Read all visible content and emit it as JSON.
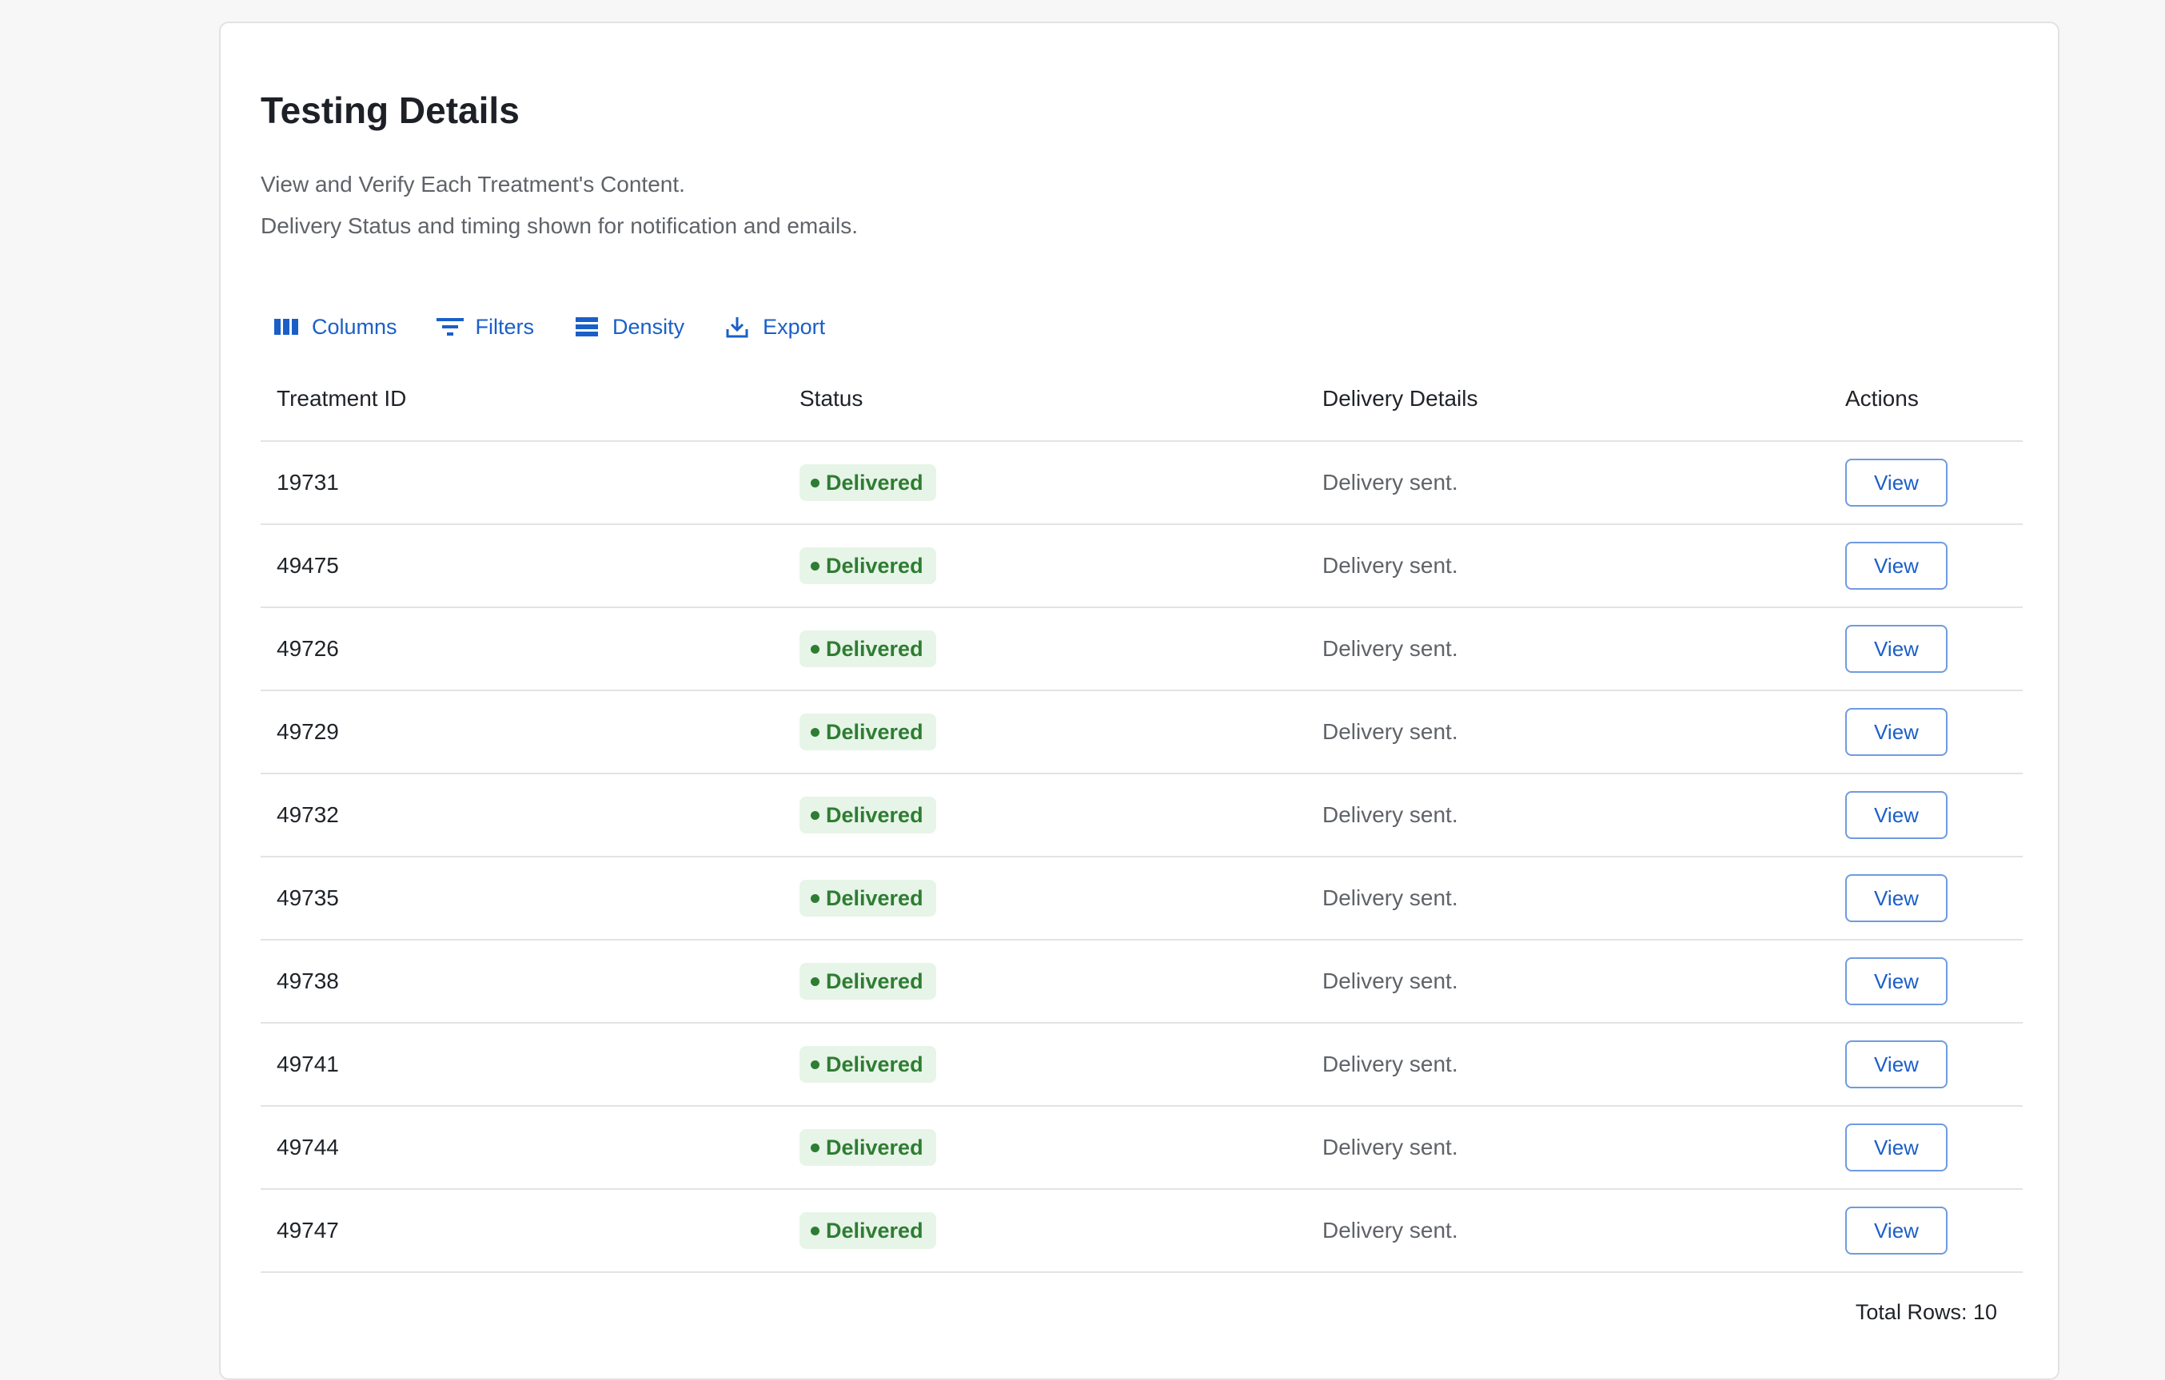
{
  "page": {
    "title": "Testing Details",
    "subtitle_line1": "View and Verify Each Treatment's Content.",
    "subtitle_line2": "Delivery Status and timing shown for notification and emails."
  },
  "toolbar": {
    "columns_label": "Columns",
    "filters_label": "Filters",
    "density_label": "Density",
    "export_label": "Export",
    "accent_color": "#1a5fc8"
  },
  "table": {
    "headers": [
      "Treatment ID",
      "Status",
      "Delivery Details",
      "Actions"
    ],
    "rows": [
      {
        "id": "19731",
        "status": "Delivered",
        "details": "Delivery sent.",
        "action": "View"
      },
      {
        "id": "49475",
        "status": "Delivered",
        "details": "Delivery sent.",
        "action": "View"
      },
      {
        "id": "49726",
        "status": "Delivered",
        "details": "Delivery sent.",
        "action": "View"
      },
      {
        "id": "49729",
        "status": "Delivered",
        "details": "Delivery sent.",
        "action": "View"
      },
      {
        "id": "49732",
        "status": "Delivered",
        "details": "Delivery sent.",
        "action": "View"
      },
      {
        "id": "49735",
        "status": "Delivered",
        "details": "Delivery sent.",
        "action": "View"
      },
      {
        "id": "49738",
        "status": "Delivered",
        "details": "Delivery sent.",
        "action": "View"
      },
      {
        "id": "49741",
        "status": "Delivered",
        "details": "Delivery sent.",
        "action": "View"
      },
      {
        "id": "49744",
        "status": "Delivered",
        "details": "Delivery sent.",
        "action": "View"
      },
      {
        "id": "49747",
        "status": "Delivered",
        "details": "Delivery sent.",
        "action": "View"
      }
    ],
    "status_color": "#2e7d32",
    "status_bg": "#e7f4e8"
  },
  "footer": {
    "total_rows": "Total Rows: 10"
  }
}
